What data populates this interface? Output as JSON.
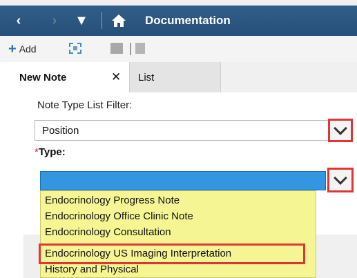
{
  "titlebar": {
    "back_icon": "‹",
    "forward_icon": "›",
    "dropdown_icon": "▼",
    "home_icon": "⌂",
    "title": "Documentation"
  },
  "toolbar": {
    "add_label": "Add",
    "add_icon": "+"
  },
  "tabs": {
    "new_note_label": "New Note",
    "close_glyph": "✕",
    "list_label": "List"
  },
  "form": {
    "filter_label": "Note Type List Filter:",
    "filter_value": "Position",
    "type_required_mark": "*",
    "type_label": "Type:",
    "type_value": ""
  },
  "dropdown": {
    "options": [
      "Endocrinology Progress Note",
      "Endocrinology Office Clinic Note",
      "Endocrinology Consultation",
      "Endocrinology US Imaging Interpretation",
      "History and Physical"
    ],
    "highlighted_index": 3
  },
  "colors": {
    "titlebar": "#2b5680",
    "highlight_border": "#e23434",
    "selected_field": "#3296e0",
    "dropdown_bg": "#f6f593"
  }
}
